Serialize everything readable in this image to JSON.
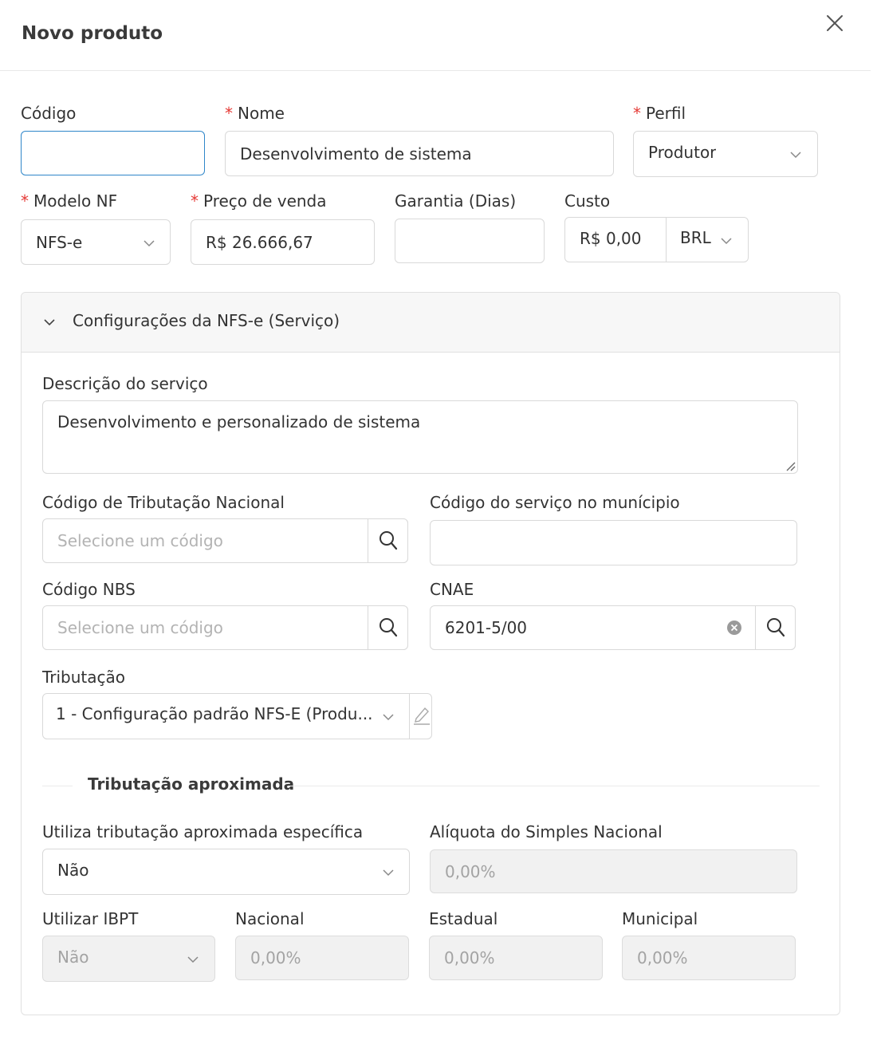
{
  "header": {
    "title": "Novo produto"
  },
  "fields": {
    "codigo": {
      "label": "Código",
      "value": ""
    },
    "nome": {
      "label": "Nome",
      "value": "Desenvolvimento de sistema"
    },
    "perfil": {
      "label": "Perfil",
      "value": "Produtor"
    },
    "modelo_nf": {
      "label": "Modelo NF",
      "value": "NFS-e"
    },
    "preco_venda": {
      "label": "Preço de venda",
      "value": "R$ 26.666,67"
    },
    "garantia": {
      "label": "Garantia (Dias)",
      "value": ""
    },
    "custo": {
      "label": "Custo",
      "value": "R$ 0,00",
      "currency": "BRL"
    }
  },
  "required_marker": "*",
  "nfse_section": {
    "title": "Configurações da NFS-e (Serviço)",
    "descricao": {
      "label": "Descrição do serviço",
      "value": "Desenvolvimento e personalizado de sistema"
    },
    "cod_trib_nacional": {
      "label": "Código de Tributação Nacional",
      "placeholder": "Selecione um código"
    },
    "cod_servico_municipio": {
      "label": "Código do serviço no munícipio",
      "value": ""
    },
    "cod_nbs": {
      "label": "Código NBS",
      "placeholder": "Selecione um código"
    },
    "cnae": {
      "label": "CNAE",
      "value": "6201-5/00"
    },
    "tributacao": {
      "label": "Tributação",
      "value": "1 - Configuração padrão NFS-E (Produ..."
    },
    "trib_aprox": {
      "title": "Tributação aproximada",
      "utiliza_especifica": {
        "label": "Utiliza tributação aproximada específica",
        "value": "Não"
      },
      "aliquota_simples": {
        "label": "Alíquota do Simples Nacional",
        "value": "0,00%"
      },
      "utilizar_ibpt": {
        "label": "Utilizar IBPT",
        "value": "Não"
      },
      "nacional": {
        "label": "Nacional",
        "value": "0,00%"
      },
      "estadual": {
        "label": "Estadual",
        "value": "0,00%"
      },
      "municipal": {
        "label": "Municipal",
        "value": "0,00%"
      }
    }
  },
  "colors": {
    "required": "#e53935",
    "focus": "#2f86c9"
  }
}
